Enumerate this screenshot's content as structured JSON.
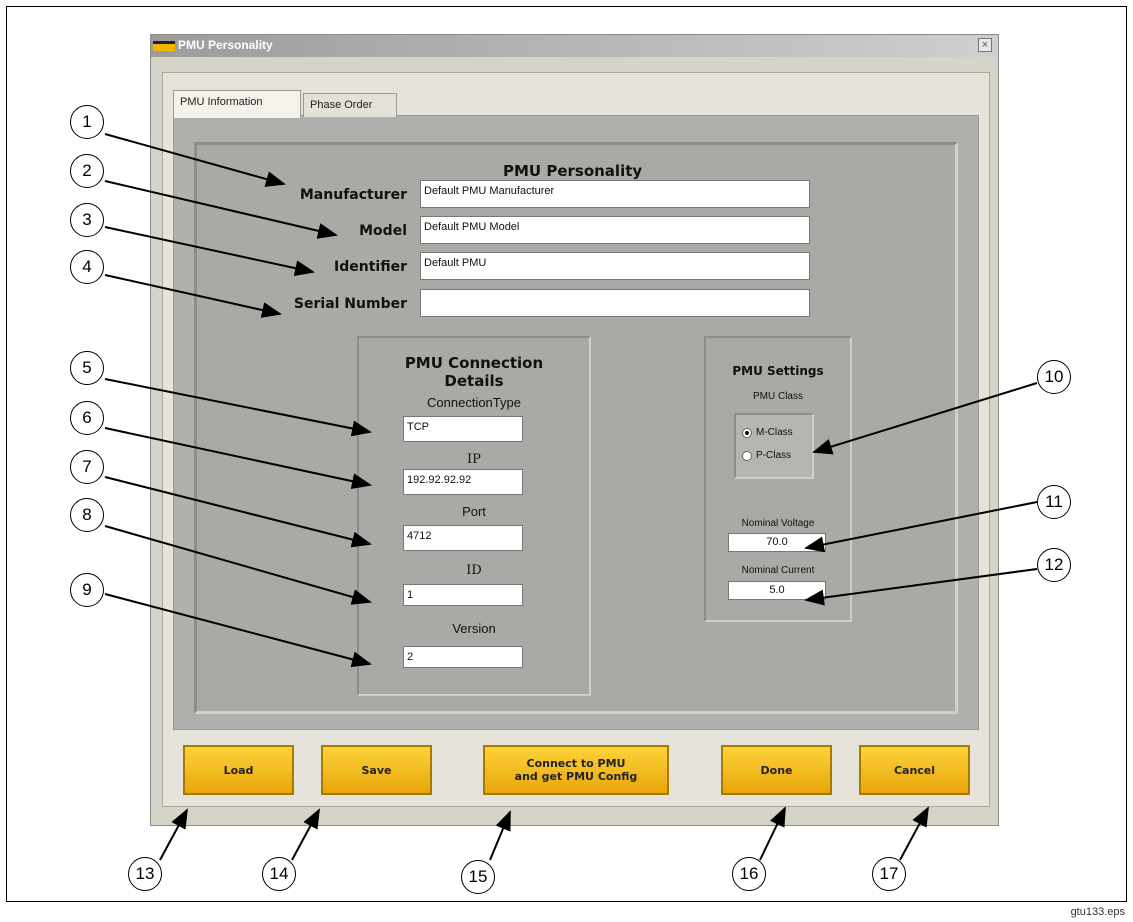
{
  "window": {
    "title": "PMU Personality",
    "close_glyph": "×"
  },
  "tabs": [
    {
      "label": "PMU Information",
      "active": true
    },
    {
      "label": "Phase Order",
      "active": false
    }
  ],
  "personality": {
    "heading": "PMU Personality",
    "manufacturer_label": "Manufacturer",
    "manufacturer_value": "Default PMU Manufacturer",
    "model_label": "Model",
    "model_value": "Default PMU Model",
    "identifier_label": "Identifier",
    "identifier_value": "Default PMU",
    "serial_label": "Serial Number",
    "serial_value": ""
  },
  "connection": {
    "heading_line1": "PMU Connection",
    "heading_line2": "Details",
    "type_label": "ConnectionType",
    "type_value": "TCP",
    "ip_label": "IP",
    "ip_value": "192.92.92.92",
    "port_label": "Port",
    "port_value": "4712",
    "id_label": "ID",
    "id_value": "1",
    "version_label": "Version",
    "version_value": "2"
  },
  "settings": {
    "heading": "PMU Settings",
    "class_label": "PMU Class",
    "class_options": [
      {
        "label": "M-Class",
        "checked": true
      },
      {
        "label": "P-Class",
        "checked": false
      }
    ],
    "voltage_label": "Nominal Voltage",
    "voltage_value": "70.0",
    "current_label": "Nominal Current",
    "current_value": "5.0"
  },
  "buttons": {
    "load": "Load",
    "save": "Save",
    "connect_line1": "Connect to PMU",
    "connect_line2": "and get PMU Config",
    "done": "Done",
    "cancel": "Cancel"
  },
  "callouts": [
    "1",
    "2",
    "3",
    "4",
    "5",
    "6",
    "7",
    "8",
    "9",
    "10",
    "11",
    "12",
    "13",
    "14",
    "15",
    "16",
    "17"
  ],
  "footer": "gtu133.eps",
  "colors": {
    "button_yellow": "#f7c321",
    "window_bg": "#d6d3c7",
    "panel_gray": "#a9a9a6"
  }
}
